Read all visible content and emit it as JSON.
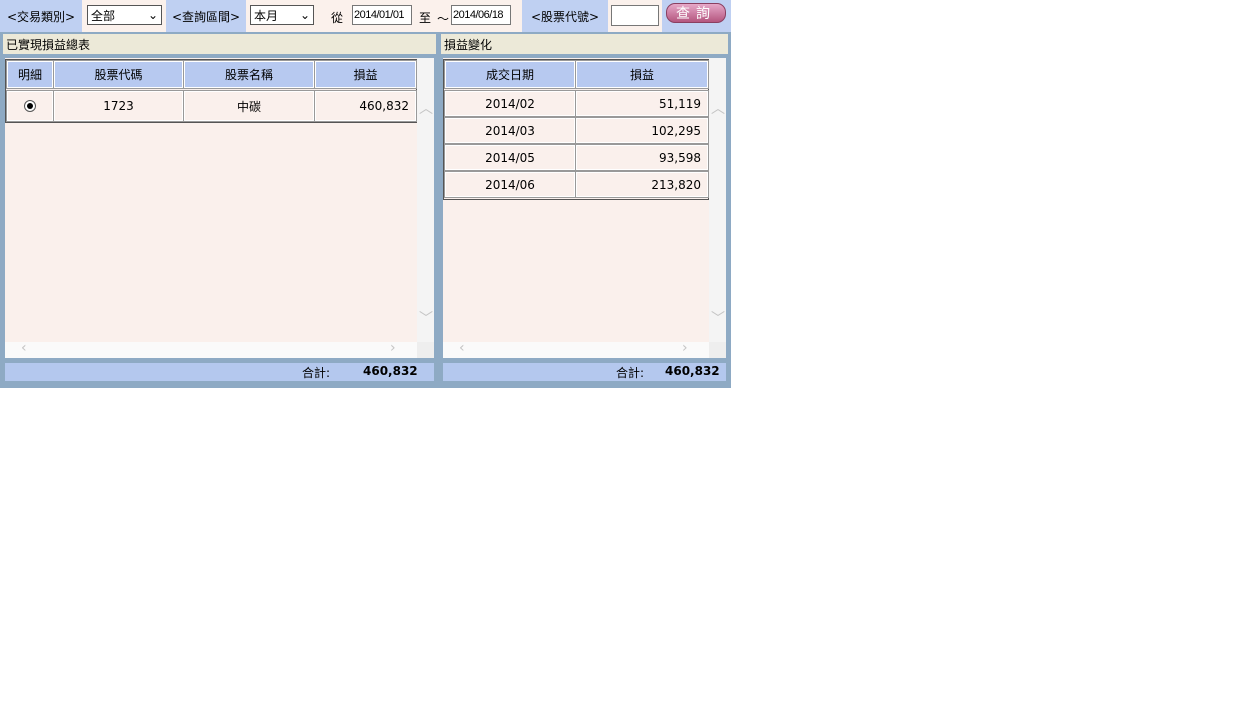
{
  "toolbar": {
    "trade_type_label": "<交易類別>",
    "trade_type_value": "全部",
    "period_label": "<查詢區間>",
    "period_value": "本月",
    "from_label": "從",
    "from_date": "2014/01/01",
    "to_label": "至",
    "tilde": "～",
    "to_date": "2014/06/18",
    "stock_code_label": "<股票代號>",
    "stock_code_value": "",
    "query_button": "查詢"
  },
  "left": {
    "title": "已實現損益總表",
    "headers": [
      "明細",
      "股票代碼",
      "股票名稱",
      "損益"
    ],
    "rows": [
      {
        "code": "1723",
        "name": "中碳",
        "pnl": "460,832",
        "selected": true
      }
    ],
    "total_label": "合計:",
    "total": "460,832"
  },
  "right": {
    "title": "損益變化",
    "headers": [
      "成交日期",
      "損益"
    ],
    "rows": [
      {
        "date": "2014/02",
        "pnl": "51,119"
      },
      {
        "date": "2014/03",
        "pnl": "102,295"
      },
      {
        "date": "2014/05",
        "pnl": "93,598"
      },
      {
        "date": "2014/06",
        "pnl": "213,820"
      }
    ],
    "total_label": "合計:",
    "total": "460,832"
  }
}
